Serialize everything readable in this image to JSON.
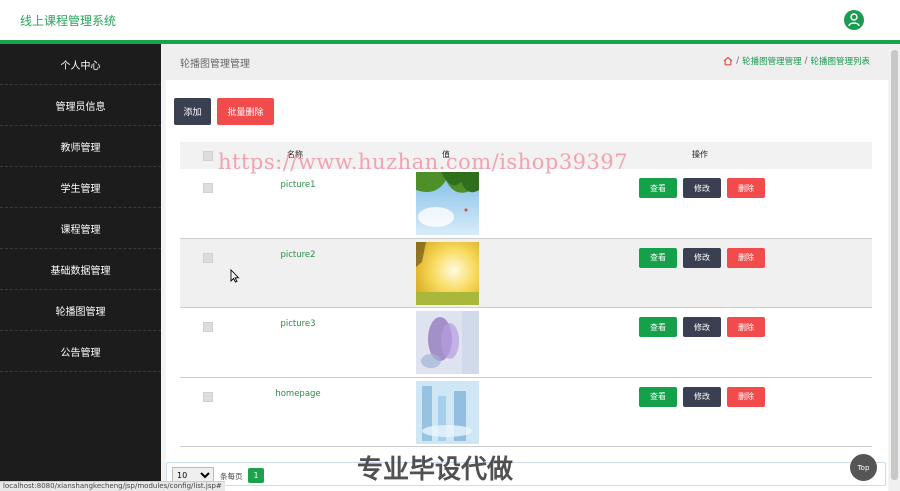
{
  "header": {
    "brand": "线上课程管理系统",
    "avatar_icon": "user-icon"
  },
  "sidebar": {
    "items": [
      {
        "label": "个人中心"
      },
      {
        "label": "管理员信息"
      },
      {
        "label": "教师管理"
      },
      {
        "label": "学生管理"
      },
      {
        "label": "课程管理"
      },
      {
        "label": "基础数据管理"
      },
      {
        "label": "轮播图管理"
      },
      {
        "label": "公告管理"
      }
    ]
  },
  "page": {
    "title": "轮播图管理管理",
    "breadcrumb": {
      "home_icon": "home-icon",
      "sep": "/",
      "level1": "轮播图管理管理",
      "level2": "轮播图管理列表"
    }
  },
  "toolbar": {
    "add_label": "添加",
    "bulk_delete_label": "批量删除"
  },
  "table": {
    "headers": {
      "name": "名称",
      "value": "值",
      "actions": "操作"
    },
    "rows": [
      {
        "name": "picture1",
        "thumb": "leaves-sky"
      },
      {
        "name": "picture2",
        "thumb": "sunlight"
      },
      {
        "name": "picture3",
        "thumb": "purple-flowers"
      },
      {
        "name": "homepage",
        "thumb": "blue-glass"
      }
    ],
    "actions": {
      "view": "查看",
      "edit": "修改",
      "delete": "删除"
    }
  },
  "pager": {
    "page_size": "10",
    "page_size_options": [
      "10"
    ],
    "per_page_label": "条每页",
    "current_page": "1"
  },
  "overlays": {
    "watermark_url": "https://www.huzhan.com/ishop39397",
    "watermark_text": "专业毕设代做",
    "status_url": "localhost:8080/xianshangkecheng/jsp/modules/config/list.jsp#",
    "top_button": "Top"
  }
}
